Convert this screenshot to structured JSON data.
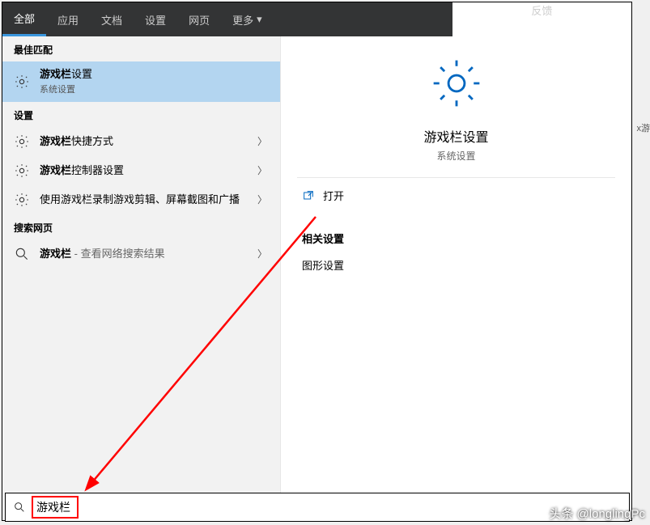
{
  "topbar": {
    "tabs": [
      "全部",
      "应用",
      "文档",
      "设置",
      "网页"
    ],
    "more": "更多",
    "feedback": "反馈"
  },
  "left": {
    "best_match_header": "最佳匹配",
    "best_match": {
      "title_bold": "游戏栏",
      "title_rest": "设置",
      "subtitle": "系统设置"
    },
    "settings_header": "设置",
    "settings_items": [
      {
        "bold": "游戏栏",
        "rest": "快捷方式"
      },
      {
        "bold": "游戏栏",
        "rest": "控制器设置"
      },
      {
        "bold": "",
        "rest": "使用游戏栏录制游戏剪辑、屏幕截图和广播"
      }
    ],
    "web_header": "搜索网页",
    "web_item": {
      "bold": "游戏栏",
      "rest": " - 查看网络搜索结果"
    }
  },
  "right": {
    "title": "游戏栏设置",
    "subtitle": "系统设置",
    "open": "打开",
    "related_header": "相关设置",
    "related_item": "图形设置"
  },
  "search": {
    "value": "游戏栏"
  },
  "side_label": "x游",
  "watermark": "头条 @longlingPc"
}
